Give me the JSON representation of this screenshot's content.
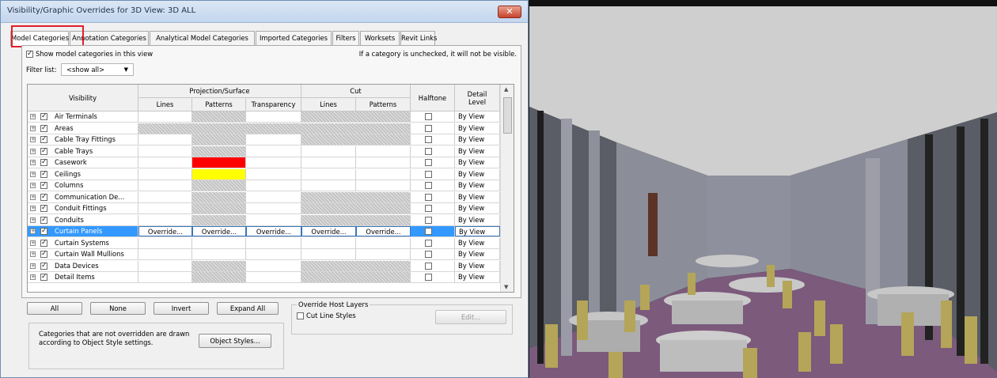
{
  "dialog": {
    "title": "Visibility/Graphic Overrides for 3D View: 3D ALL",
    "close_glyph": "✕"
  },
  "tabs": [
    "Model Categories",
    "Annotation Categories",
    "Analytical Model Categories",
    "Imported Categories",
    "Filters",
    "Worksets",
    "Revit Links"
  ],
  "options": {
    "show_label": "Show model categories in this view",
    "show_checked": true,
    "hint": "If a category is unchecked, it will not be visible.",
    "filter_label": "Filter list:",
    "filter_value": "<show all>"
  },
  "grid": {
    "headers": {
      "visibility": "Visibility",
      "projection_surface": "Projection/Surface",
      "cut": "Cut",
      "halftone": "Halftone",
      "detail_level": "Detail Level",
      "lines": "Lines",
      "patterns": "Patterns",
      "transparency": "Transparency",
      "cut_lines": "Lines",
      "cut_patterns": "Patterns"
    },
    "override_label": "Override...",
    "rows": [
      {
        "name": "Air Terminals",
        "detail": "By View"
      },
      {
        "name": "Areas",
        "detail": "By View"
      },
      {
        "name": "Cable Tray Fittings",
        "detail": "By View"
      },
      {
        "name": "Cable Trays",
        "detail": "By View"
      },
      {
        "name": "Casework",
        "detail": "By View",
        "pattern_color": "#ff0000"
      },
      {
        "name": "Ceilings",
        "detail": "By View",
        "pattern_color": "#ffff00"
      },
      {
        "name": "Columns",
        "detail": "By View"
      },
      {
        "name": "Communication De...",
        "detail": "By View"
      },
      {
        "name": "Conduit Fittings",
        "detail": "By View"
      },
      {
        "name": "Conduits",
        "detail": "By View"
      },
      {
        "name": "Curtain Panels",
        "detail": "By View",
        "selected": true
      },
      {
        "name": "Curtain Systems",
        "detail": "By View"
      },
      {
        "name": "Curtain Wall Mullions",
        "detail": "By View"
      },
      {
        "name": "Data Devices",
        "detail": "By View"
      },
      {
        "name": "Detail Items",
        "detail": "By View"
      }
    ]
  },
  "buttons": {
    "all": "All",
    "none": "None",
    "invert": "Invert",
    "expand_all": "Expand All",
    "object_styles": "Object Styles...",
    "edit": "Edit..."
  },
  "override_host": {
    "title": "Override Host Layers",
    "cut_line_styles": "Cut Line Styles"
  },
  "note": "Categories that are not overridden are drawn according to Object Style settings.",
  "colors": {
    "selection": "#3399ff",
    "casework_pattern": "#ff0000",
    "ceilings_pattern": "#ffff00",
    "floor": "#7b5a7c",
    "ceiling": "#cfcfcf",
    "walls": "#8d8f9b"
  }
}
